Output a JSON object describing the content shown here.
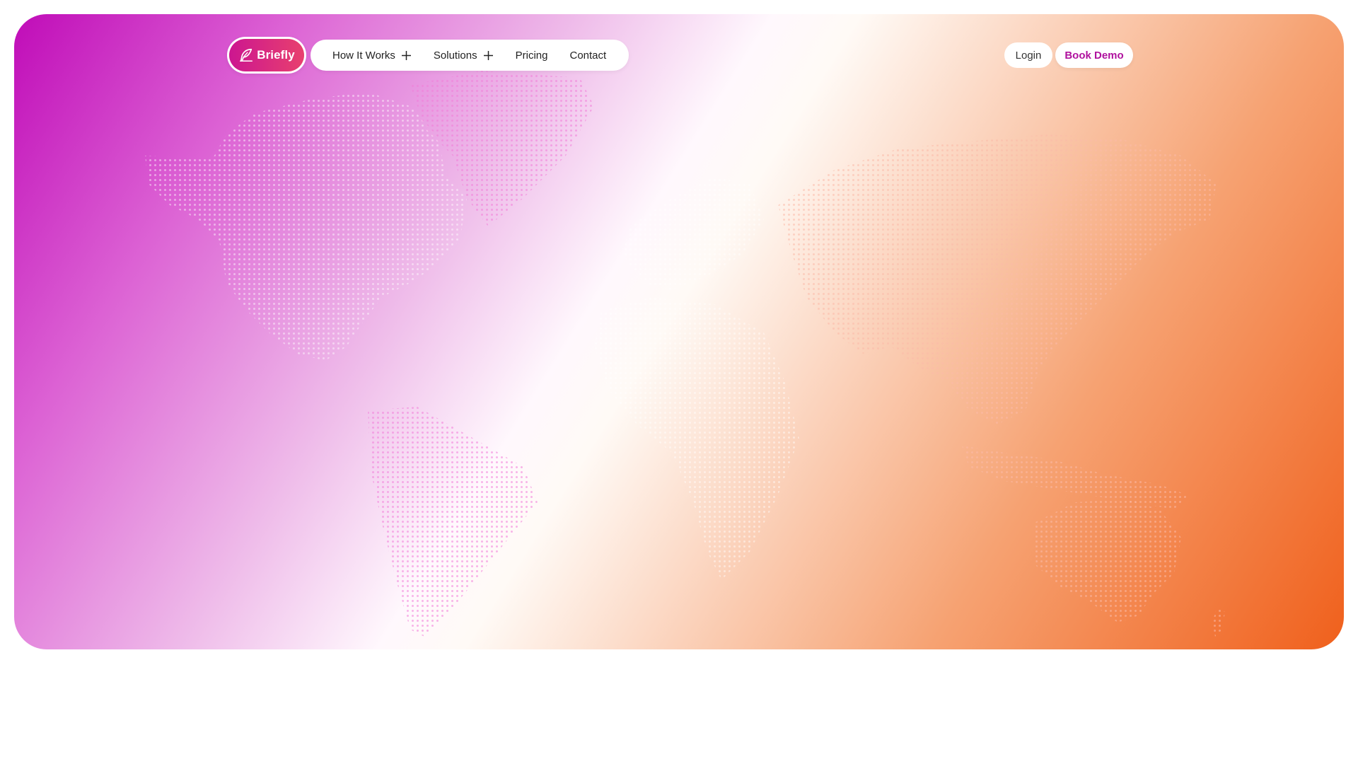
{
  "brand": {
    "name": "Briefly",
    "icon": "feather-icon",
    "gradient_start": "#cc1690",
    "gradient_end": "#e8406e"
  },
  "nav": {
    "items": [
      {
        "label": "How It Works",
        "expandable": true,
        "icon": "plus-icon"
      },
      {
        "label": "Solutions",
        "expandable": true,
        "icon": "plus-icon"
      },
      {
        "label": "Pricing",
        "expandable": false
      },
      {
        "label": "Contact",
        "expandable": false
      }
    ],
    "login_label": "Login",
    "demo_label": "Book Demo"
  },
  "hero": {
    "background": "world-map-dot-pattern",
    "gradient_colors": [
      "#c00cb8",
      "#ffffff",
      "#f0601c"
    ]
  },
  "colors": {
    "accent": "#b0129e"
  }
}
